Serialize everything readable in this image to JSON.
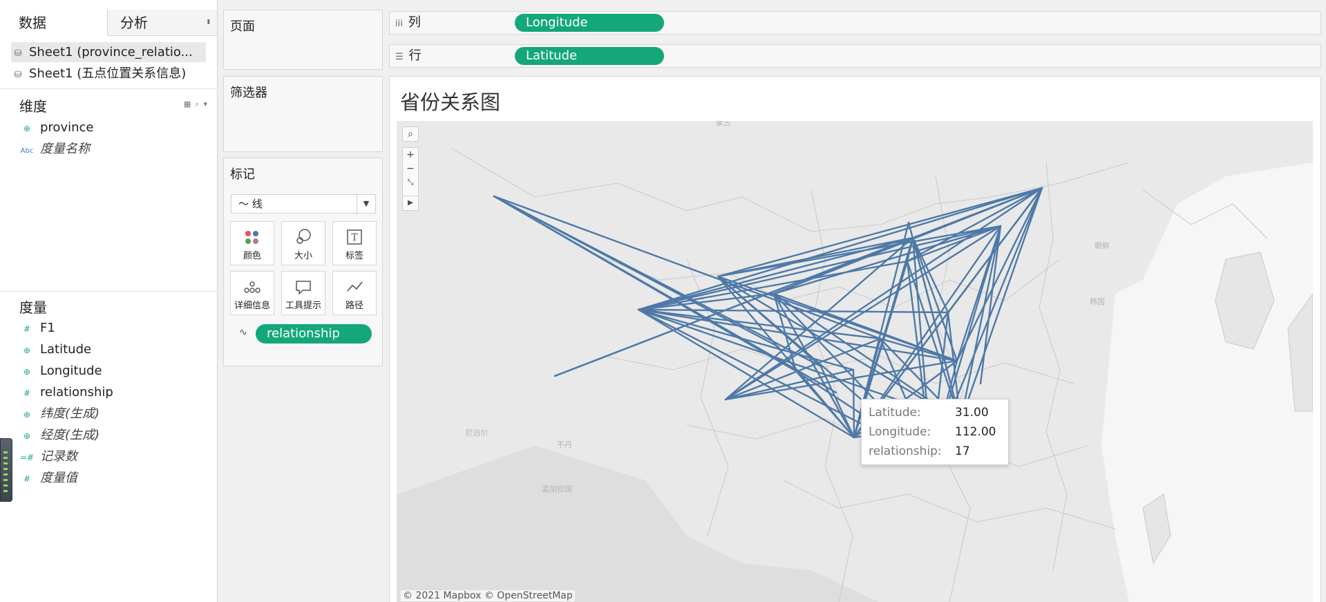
{
  "data_pane": {
    "tabs": [
      "数据",
      "分析"
    ],
    "sources": [
      "Sheet1 (province_relatio...",
      "Sheet1 (五点位置关系信息)"
    ],
    "dimensions_title": "维度",
    "dimensions": [
      {
        "label": "province",
        "icon": "globe-icon"
      },
      {
        "label": "度量名称",
        "icon": "abc-icon"
      }
    ],
    "measures_title": "度量",
    "measures": [
      {
        "label": "F1",
        "icon": "hash-icon"
      },
      {
        "label": "Latitude",
        "icon": "globe-icon"
      },
      {
        "label": "Longitude",
        "icon": "globe-icon"
      },
      {
        "label": "relationship",
        "icon": "hash-icon"
      },
      {
        "label": "纬度(生成)",
        "icon": "globe-icon"
      },
      {
        "label": "经度(生成)",
        "icon": "globe-icon"
      },
      {
        "label": "记录数",
        "icon": "hash-icon"
      },
      {
        "label": "度量值",
        "icon": "hash-icon"
      }
    ]
  },
  "cards": {
    "pages": "页面",
    "filters": "筛选器",
    "marks": "标记",
    "mark_type": "线",
    "mark_buttons": [
      "颜色",
      "大小",
      "标签",
      "详细信息",
      "工具提示",
      "路径"
    ],
    "path_field": "relationship"
  },
  "shelves": {
    "columns_label": "列",
    "columns_pill": "Longitude",
    "rows_label": "行",
    "rows_pill": "Latitude"
  },
  "view": {
    "title": "省份关系图",
    "attribution": "© 2021 Mapbox © OpenStreetMap",
    "line_color": "#4e79a7",
    "tooltip": {
      "k1": "Latitude:",
      "v1": "31.00",
      "k2": "Longitude:",
      "v2": "112.00",
      "k3": "relationship:",
      "v3": "17"
    }
  },
  "colors": {
    "pill": "#14a77a",
    "accent_green": "#23a98c"
  }
}
